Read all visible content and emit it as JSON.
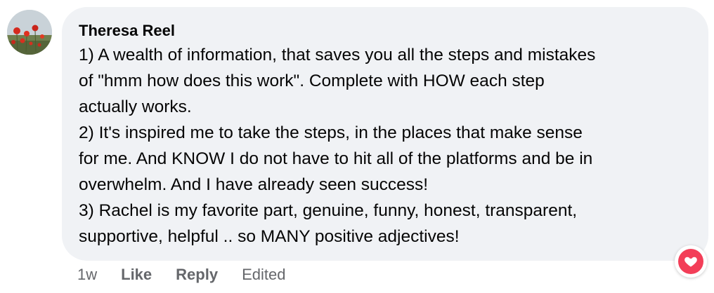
{
  "comment": {
    "author": "Theresa Reel",
    "lines": [
      "1) A wealth of information, that saves you all the steps and mistakes",
      "of \"hmm how does this work\". Complete with HOW each step",
      "actually works.",
      "2) It's inspired me to take the steps, in the places that make sense",
      "for me. And KNOW I do not have to hit all of the platforms and be in",
      "overwhelm. And I have already seen success!",
      "3) Rachel is my favorite part, genuine, funny, honest, transparent,",
      "supportive, helpful .. so MANY positive adjectives!"
    ],
    "timestamp": "1w",
    "like_label": "Like",
    "reply_label": "Reply",
    "edited_label": "Edited",
    "reaction": "heart-icon"
  },
  "colors": {
    "bubble": "#f0f2f5",
    "text": "#050505",
    "meta": "#65676b",
    "heart": "#f33e58"
  }
}
